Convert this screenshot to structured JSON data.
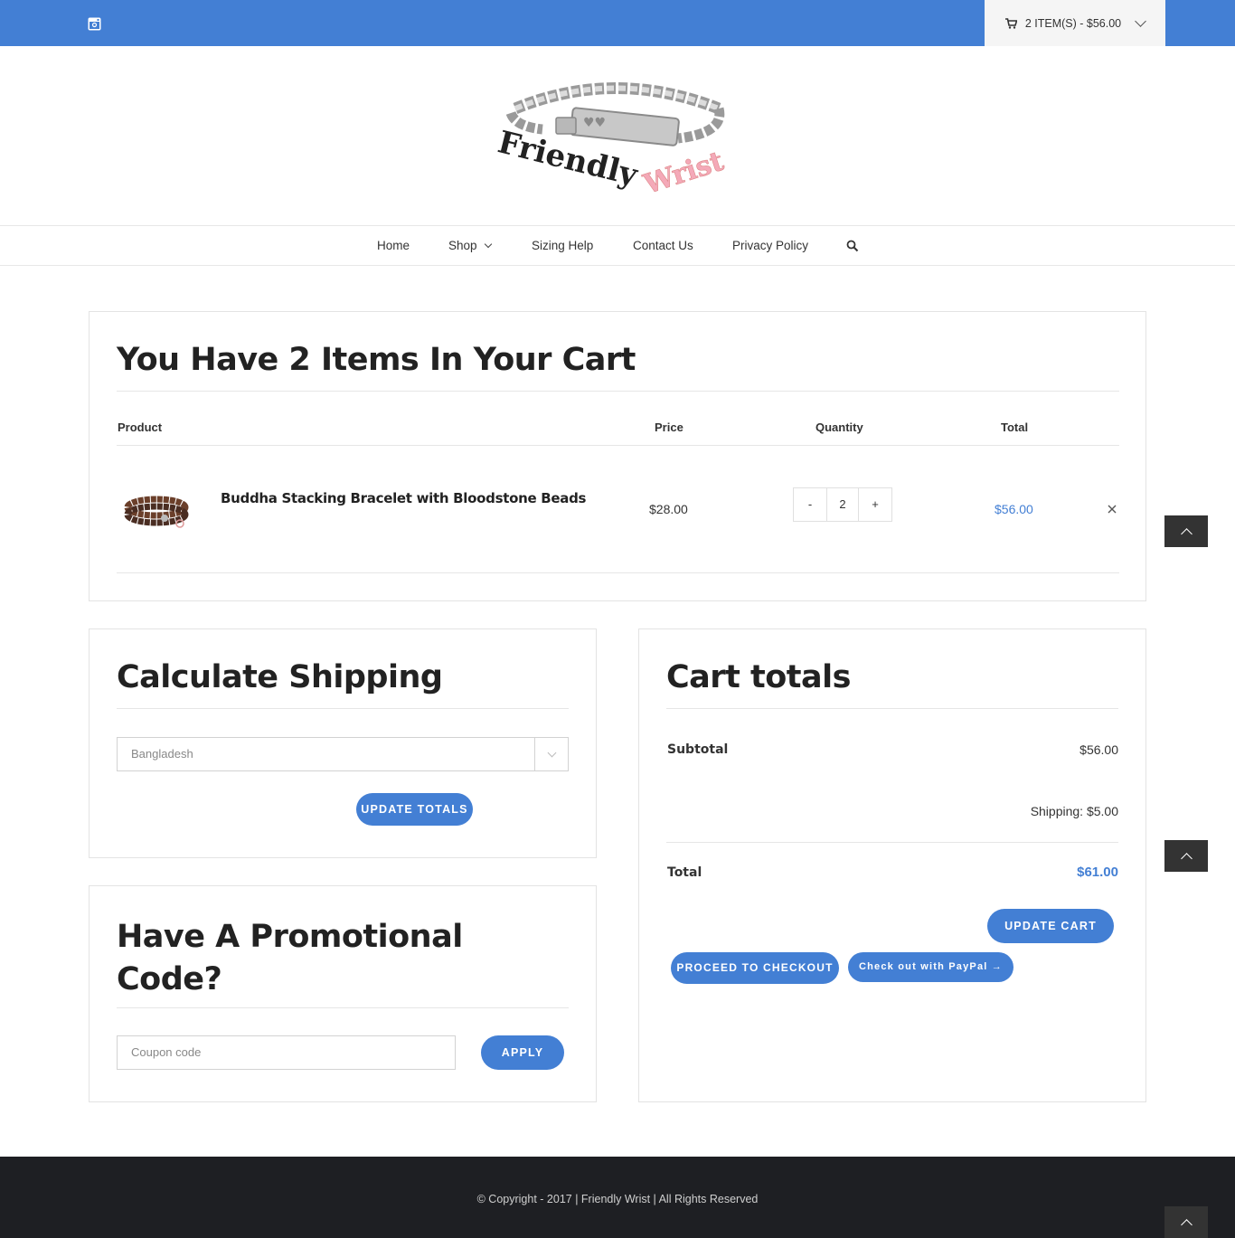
{
  "topbar": {
    "social_icon": "instagram-icon",
    "cart_icon": "shopping-cart-icon",
    "cart_summary": "2 ITEM(S) - $56.00",
    "color": "#437fd4"
  },
  "logo": {
    "word1": "Friendly",
    "word2": "Wrist"
  },
  "nav": {
    "items": [
      "Home",
      "Shop",
      "Sizing Help",
      "Contact Us",
      "Privacy Policy"
    ],
    "search_icon": "search-icon"
  },
  "cart": {
    "title": "You Have 2 Items In Your Cart",
    "columns": [
      "Product",
      "Price",
      "Quantity",
      "Total"
    ],
    "rows": [
      {
        "product": "Buddha Stacking Bracelet with Bloodstone Beads",
        "price": "$28.00",
        "quantity": "2",
        "total": "$56.00",
        "minus": "-",
        "plus": "+"
      }
    ]
  },
  "shipping": {
    "title": "Calculate Shipping",
    "country": "Bangladesh",
    "button": "UPDATE TOTALS"
  },
  "promo": {
    "title": "Have A Promotional Code?",
    "placeholder": "Coupon code",
    "button": "APPLY"
  },
  "totals": {
    "title": "Cart totals",
    "subtotal_label": "Subtotal",
    "subtotal_value": "$56.00",
    "shipping_text": "Shipping: $5.00",
    "total_label": "Total",
    "total_value": "$61.00",
    "update_cart": "UPDATE CART",
    "checkout": "PROCEED TO CHECKOUT",
    "paypal": "Check out with PayPal →"
  },
  "footer": {
    "text": "© Copyright - 2017 | Friendly Wrist | All Rights Reserved"
  }
}
